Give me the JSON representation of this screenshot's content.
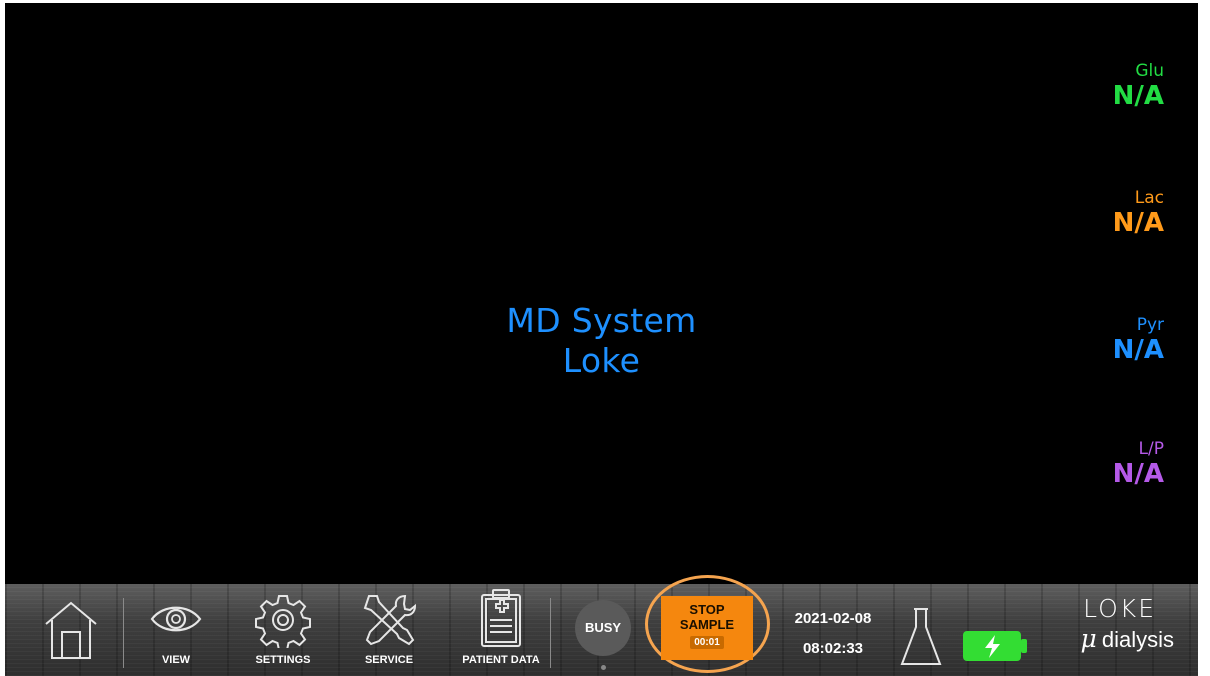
{
  "main": {
    "title_line1": "MD System",
    "title_line2": "Loke"
  },
  "metrics": [
    {
      "label": "Glu",
      "value": "N/A",
      "color": "#22dd44"
    },
    {
      "label": "Lac",
      "value": "N/A",
      "color": "#ff9a1a"
    },
    {
      "label": "Pyr",
      "value": "N/A",
      "color": "#1e90ff"
    },
    {
      "label": "L/P",
      "value": "N/A",
      "color": "#b55ae8"
    }
  ],
  "bottom_bar": {
    "home_icon": "home-icon",
    "view_label": "VIEW",
    "settings_label": "SETTINGS",
    "service_label": "SERVICE",
    "patient_data_label": "PATIENT DATA",
    "busy_label": "BUSY",
    "stop_sample_line1": "STOP",
    "stop_sample_line2": "SAMPLE",
    "stop_sample_timer": "00:01",
    "date": "2021-02-08",
    "time": "08:02:33",
    "flask_icon": "flask-icon",
    "battery_icon": "battery-charging-icon",
    "battery_color": "#33dd33",
    "highlight_color": "#f5a44f"
  },
  "logo": {
    "brand": "LOKE",
    "mu": "μ",
    "dialysis": "dialysis"
  }
}
